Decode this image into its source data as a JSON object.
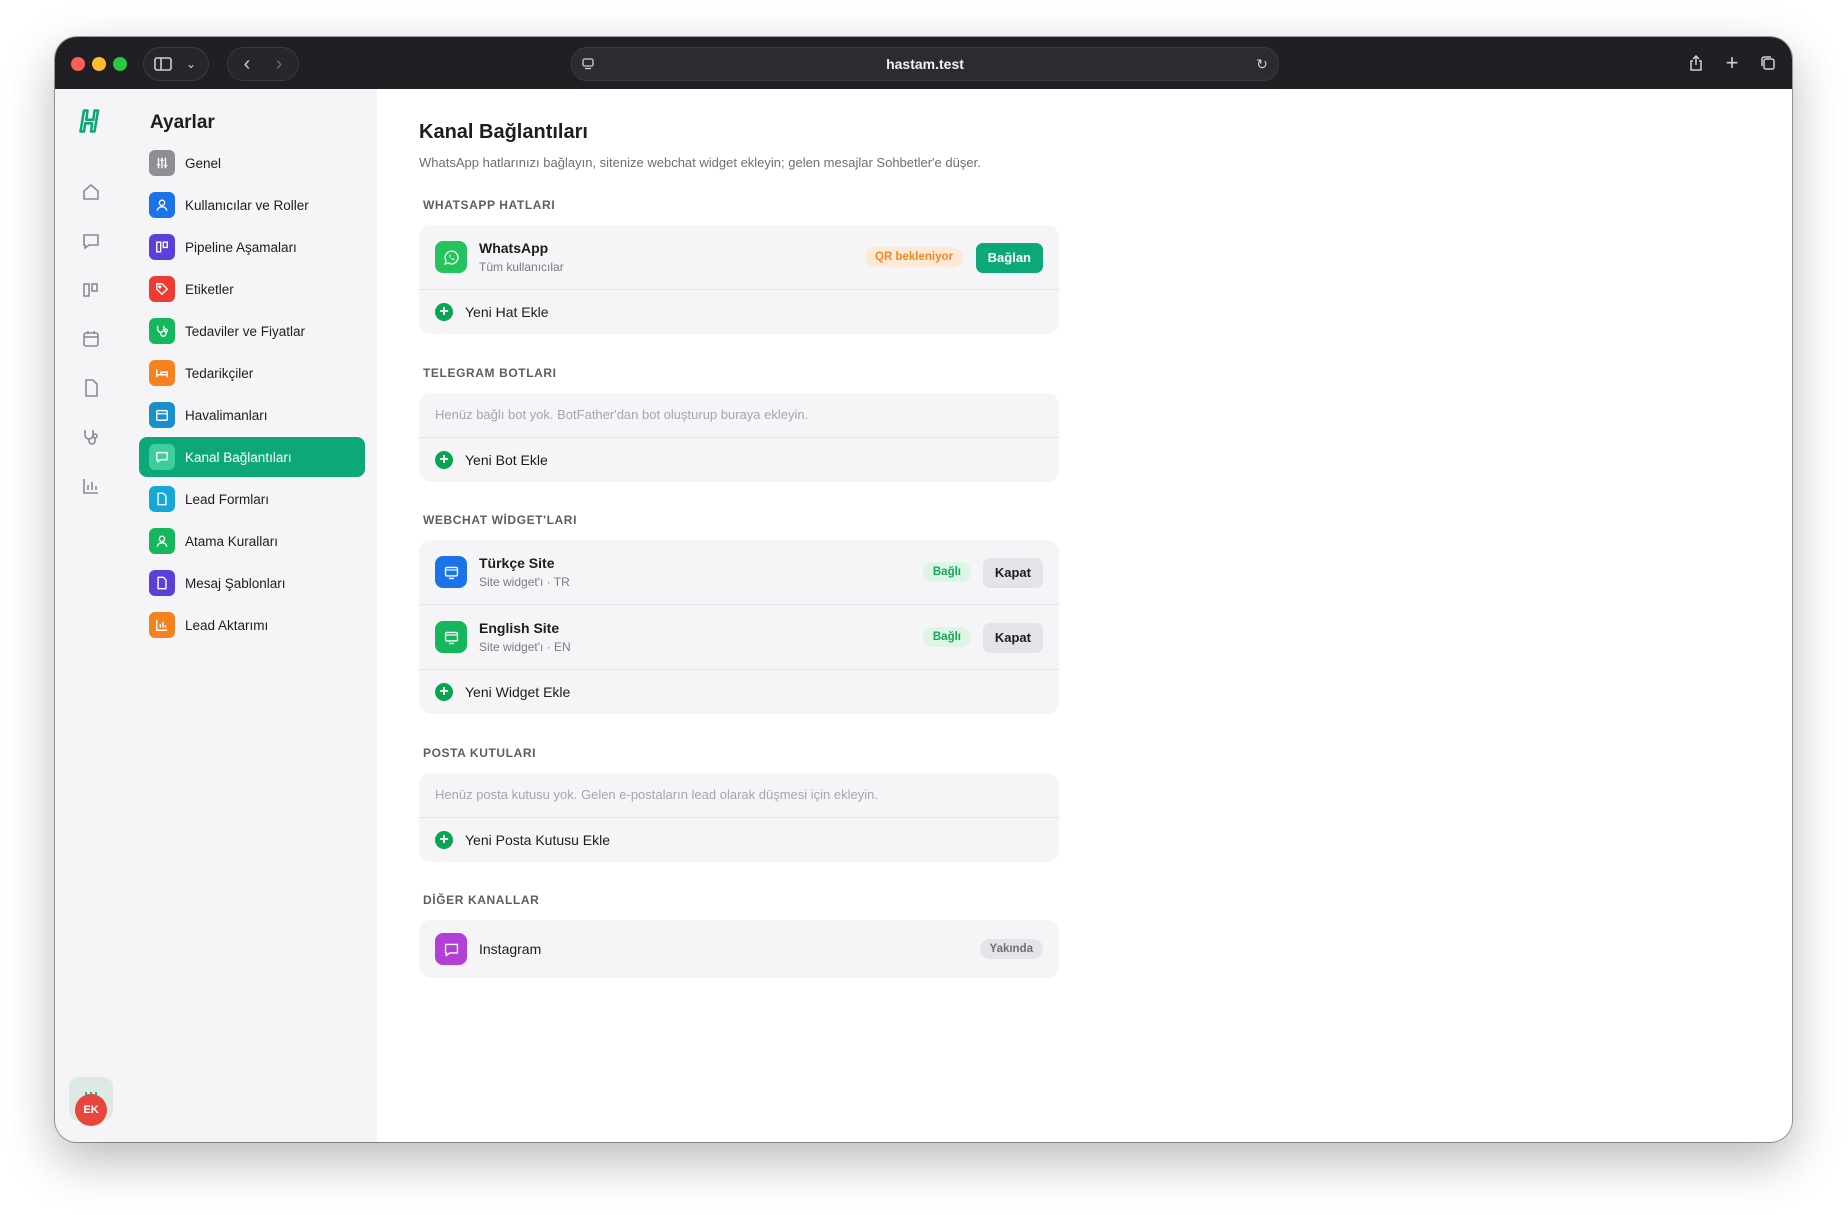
{
  "browser": {
    "url": "hastam.test",
    "dot_colors": [
      "#ff5f57",
      "#febc2e",
      "#28c840"
    ]
  },
  "rail": {
    "items": [
      "home-icon",
      "chat-icon",
      "kanban-icon",
      "calendar-icon",
      "document-icon",
      "stethoscope-icon",
      "chart-icon"
    ],
    "settings_icon": "sliders-icon",
    "avatar": "EK"
  },
  "sidebar": {
    "title": "Ayarlar",
    "items": [
      {
        "label": "Genel",
        "icon": "sliders-icon",
        "color": "#8e8e93"
      },
      {
        "label": "Kullanıcılar ve Roller",
        "icon": "user-icon",
        "color": "#1a73e8"
      },
      {
        "label": "Pipeline Aşamaları",
        "icon": "kanban-icon",
        "color": "#5b3fd6"
      },
      {
        "label": "Etiketler",
        "icon": "tag-icon",
        "color": "#ef3b32"
      },
      {
        "label": "Tedaviler ve Fiyatlar",
        "icon": "stethoscope-icon",
        "color": "#14b85a"
      },
      {
        "label": "Tedarikçiler",
        "icon": "bed-icon",
        "color": "#f5821f"
      },
      {
        "label": "Havalimanları",
        "icon": "calendar-icon",
        "color": "#1a8fc9"
      },
      {
        "label": "Kanal Bağlantıları",
        "icon": "chat-icon",
        "color": "#3ccf9c",
        "active": true
      },
      {
        "label": "Lead Formları",
        "icon": "document-icon",
        "color": "#14a8d6"
      },
      {
        "label": "Atama Kuralları",
        "icon": "user-icon",
        "color": "#14b85a"
      },
      {
        "label": "Mesaj Şablonları",
        "icon": "document-icon",
        "color": "#5b3fd6"
      },
      {
        "label": "Lead Aktarımı",
        "icon": "chart-icon",
        "color": "#f5821f"
      }
    ]
  },
  "page": {
    "title": "Kanal Bağlantıları",
    "subtitle": "WhatsApp hatlarınızı bağlayın, sitenize webchat widget ekleyin; gelen mesajlar Sohbetler'e düşer.",
    "whatsapp": {
      "heading": "WHATSAPP HATLARI",
      "rows": [
        {
          "name": "WhatsApp",
          "detail": "Tüm kullanıcılar",
          "status": "QR bekleniyor",
          "action": "Bağlan"
        }
      ],
      "add_label": "Yeni Hat Ekle"
    },
    "telegram": {
      "heading": "TELEGRAM BOTLARI",
      "empty": "Henüz bağlı bot yok. BotFather'dan bot oluşturup buraya ekleyin.",
      "add_label": "Yeni Bot Ekle"
    },
    "webchat": {
      "heading": "WEBCHAT WİDGET'LARI",
      "rows": [
        {
          "name": "Türkçe Site",
          "detail": "Site widget'ı · TR",
          "status": "Bağlı",
          "action": "Kapat",
          "icon_color": "#1a73e8"
        },
        {
          "name": "English Site",
          "detail": "Site widget'ı · EN",
          "status": "Bağlı",
          "action": "Kapat",
          "icon_color": "#14b85a"
        }
      ],
      "add_label": "Yeni Widget Ekle"
    },
    "mailboxes": {
      "heading": "POSTA KUTULARI",
      "empty": "Henüz posta kutusu yok. Gelen e-postaların lead olarak düşmesi için ekleyin.",
      "add_label": "Yeni Posta Kutusu Ekle"
    },
    "other": {
      "heading": "DİĞER KANALLAR",
      "rows": [
        {
          "name": "Instagram",
          "status": "Yakında"
        }
      ]
    }
  },
  "colors": {
    "accent": "#0da87a",
    "whatsapp": "#25c35e",
    "instagram": "#b23fd6",
    "pending_bg": "#fde9d6",
    "pending_text": "#f08a24",
    "connected_bg": "#dcf5e5",
    "connected_text": "#15a957"
  }
}
